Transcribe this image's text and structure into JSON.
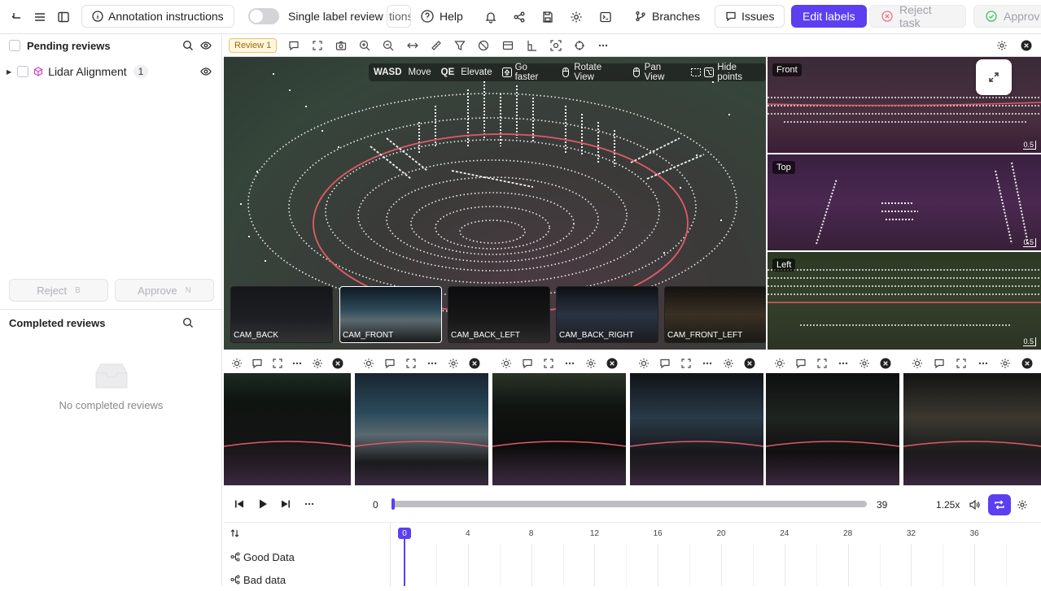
{
  "topbar": {
    "annotation_instructions": "Annotation instructions",
    "single_label_review": "Single label review",
    "truncated_tab": "tions",
    "help": "Help",
    "branches": "Branches",
    "issues": "Issues",
    "edit_labels": "Edit labels",
    "reject_task": "Reject task",
    "approve": "Approv"
  },
  "sidebar": {
    "pending_title": "Pending reviews",
    "tree_item_label": "Lidar Alignment",
    "tree_item_count": "1",
    "reject_label": "Reject",
    "reject_key": "B",
    "approve_label": "Approve",
    "approve_key": "N",
    "completed_title": "Completed reviews",
    "empty_text": "No completed reviews"
  },
  "viewer": {
    "review_badge": "Review 1",
    "hud": {
      "move_key": "WASD",
      "move": "Move",
      "elevate_key": "QE",
      "elevate": "Elevate",
      "faster": "Go faster",
      "rotate": "Rotate View",
      "pan": "Pan View",
      "hide": "Hide points"
    },
    "cameras": [
      "CAM_BACK",
      "CAM_FRONT",
      "CAM_BACK_LEFT",
      "CAM_BACK_RIGHT",
      "CAM_FRONT_LEFT"
    ],
    "ortho": {
      "front": "Front",
      "top": "Top",
      "left": "Left",
      "scale": "0.5"
    }
  },
  "player": {
    "start_frame": "0",
    "end_frame": "39",
    "speed": "1.25x",
    "progress_fraction": 0
  },
  "timeline": {
    "current": "0",
    "ticks": [
      "4",
      "8",
      "12",
      "16",
      "20",
      "24",
      "28",
      "32",
      "36"
    ],
    "tracks": [
      "Good Data",
      "Bad data"
    ]
  },
  "colors": {
    "accent": "#5b3ff0",
    "trajectory": "#e05a6a"
  }
}
